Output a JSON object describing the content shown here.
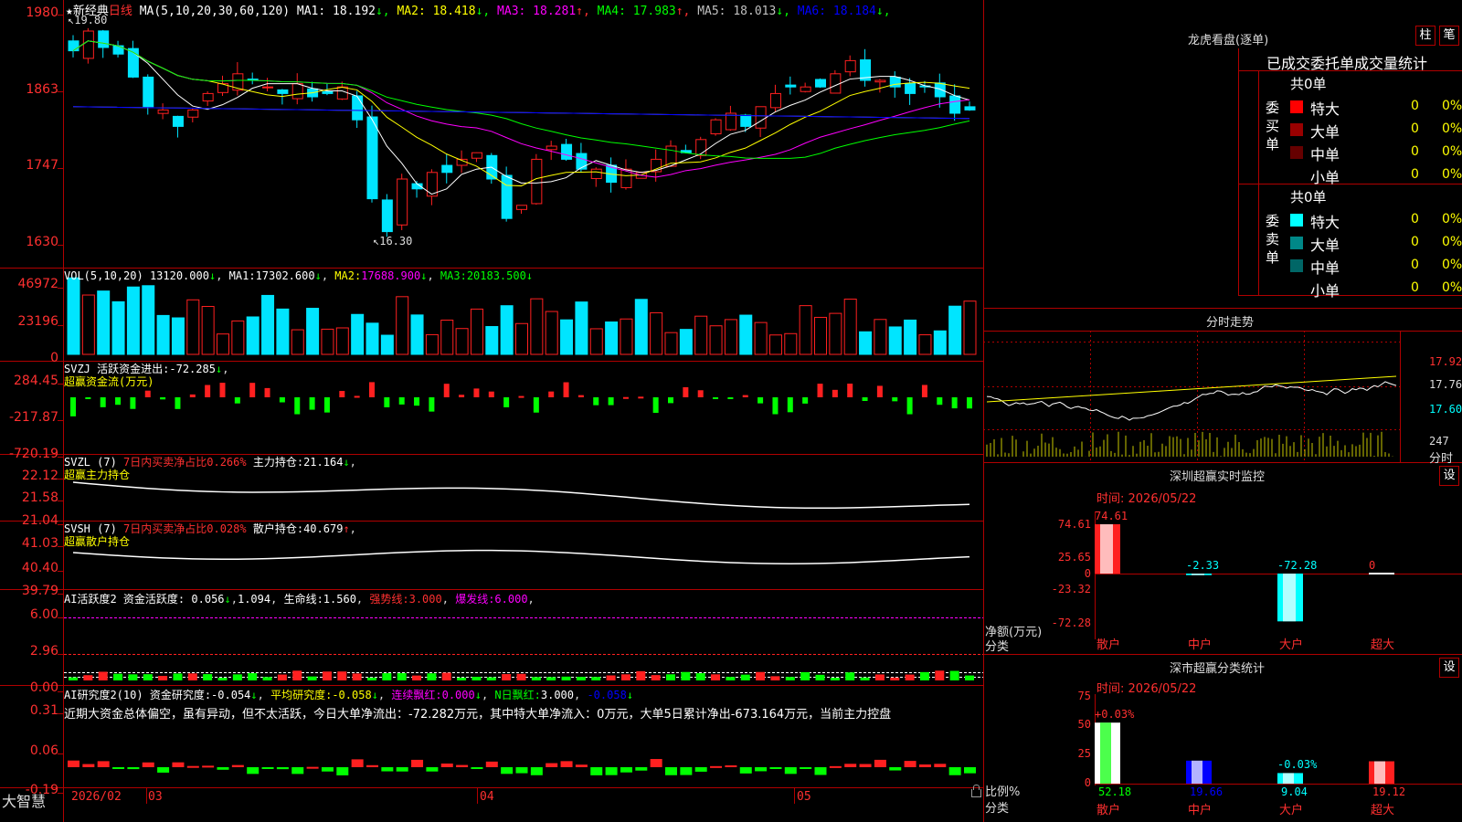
{
  "app": {
    "brand": "大智慧",
    "lock_icon": "lock-icon"
  },
  "kline": {
    "header": {
      "star": "★",
      "name": "新经典",
      "period": "日线",
      "ma_params": "MA(5,10,20,30,60,120)",
      "items": [
        {
          "label": "MA1:",
          "value": "18.192",
          "arrow": "↓",
          "color": "#ffffff"
        },
        {
          "label": "MA2:",
          "value": "18.418",
          "arrow": "↓",
          "color": "#ffff00"
        },
        {
          "label": "MA3:",
          "value": "18.281",
          "arrow": "↑",
          "color": "#ff00ff"
        },
        {
          "label": "MA4:",
          "value": "17.983",
          "arrow": "↑",
          "color": "#00ff00"
        },
        {
          "label": "MA5:",
          "value": "18.013",
          "arrow": "↓",
          "color": "#c0c0c0"
        },
        {
          "label": "MA6:",
          "value": "18.184",
          "arrow": "↓",
          "color": "#0000ff"
        }
      ]
    },
    "y_ticks": [
      "1980",
      "1863",
      "1747",
      "1630"
    ],
    "high_label": "19.80",
    "low_label": "16.30"
  },
  "volume": {
    "header": {
      "name": "VOL(5,10,20)",
      "value": "13120.000",
      "arrow": "↓",
      "ma1": "17302.600",
      "ma2": "17688.900",
      "ma3": "20183.500"
    },
    "ma_labels": [
      "MA1:",
      "MA2:",
      "MA3:"
    ],
    "y_ticks": [
      "46972",
      "23196",
      "0"
    ]
  },
  "svzj": {
    "header": {
      "name": "SVZJ",
      "label": "活跃资金进出:",
      "value": "-72.285",
      "arrow": "↓",
      "sub": "超赢资金流(万元)"
    },
    "y_ticks": [
      "284.45",
      "-217.87",
      "-720.19"
    ]
  },
  "svzl": {
    "header": {
      "name": "SVZL (7)",
      "label1": "7日内买卖净占比0.266%",
      "label2": "主力持仓:",
      "value": "21.164",
      "arrow": "↓",
      "sub": "超赢主力持仓"
    },
    "y_ticks": [
      "22.12",
      "21.58",
      "21.04"
    ]
  },
  "svsh": {
    "header": {
      "name": "SVSH (7)",
      "label1": "7日内买卖净占比0.028%",
      "label2": "散户持仓:",
      "value": "40.679",
      "arrow": "↑",
      "sub": "超赢散户持仓"
    },
    "y_ticks": [
      "41.03",
      "40.40",
      "39.79"
    ]
  },
  "ai_active": {
    "header": {
      "name": "AI活跃度2",
      "label": "资金活跃度:",
      "v1": "0.056",
      "a1": "↓",
      "v2": "1.094",
      "life": "生命线:",
      "v3": "1.560",
      "strong": "强势线:",
      "v4": "3.000",
      "burst": "爆发线:",
      "v5": "6.000"
    },
    "y_ticks": [
      "6.00",
      "2.96",
      "0.00"
    ]
  },
  "ai_research": {
    "header": {
      "name": "AI研究度2(10)",
      "label": "资金研究度:",
      "v1": "-0.054",
      "a1": "↓",
      "avg": "平均研究度:",
      "v2": "-0.058",
      "a2": "↓",
      "lx": "连续飘红:",
      "v3": "0.000",
      "a3": "↓",
      "nr": "N日飘红:",
      "v4": "3.000",
      "v5": "-0.058",
      "a5": "↓"
    },
    "comment": "近期大资金总体偏空，虽有异动，但不太活跃，今日大单净流出：-72.282万元，其中特大单净流入：0万元，大单5日累计净出-673.164万元，当前主力控盘",
    "y_ticks": [
      "0.31",
      "0.06",
      "-0.19"
    ]
  },
  "timeline": {
    "date1": "2026/02",
    "m3": "03",
    "m4": "04",
    "m5": "05"
  },
  "right": {
    "dragon_title": "龙虎看盘(逐单)",
    "tab_bar": "柱",
    "tab_pen": "笔",
    "stats_title": "已成交委托单成交量统计",
    "buy_side": {
      "label": "委买单",
      "total": "共0单",
      "rows": [
        {
          "name": "特大",
          "count": "0",
          "pct": "0%",
          "color": "#ff0000"
        },
        {
          "name": "大单",
          "count": "0",
          "pct": "0%",
          "color": "#990000"
        },
        {
          "name": "中单",
          "count": "0",
          "pct": "0%",
          "color": "#660000"
        },
        {
          "name": "小单",
          "count": "0",
          "pct": "0%",
          "color": "#000000"
        }
      ]
    },
    "sell_side": {
      "label": "委卖单",
      "total": "共0单",
      "rows": [
        {
          "name": "特大",
          "count": "0",
          "pct": "0%",
          "color": "#00ffff"
        },
        {
          "name": "大单",
          "count": "0",
          "pct": "0%",
          "color": "#008888"
        },
        {
          "name": "中单",
          "count": "0",
          "pct": "0%",
          "color": "#006666"
        },
        {
          "name": "小单",
          "count": "0",
          "pct": "0%",
          "color": "#000000"
        }
      ]
    },
    "intraday": {
      "title": "分时走势",
      "prices": [
        "17.92",
        "17.76",
        "17.60"
      ],
      "vol": "247",
      "vol_label": "分时"
    },
    "monitor": {
      "title": "深圳超赢实时监控",
      "set": "设",
      "time": "时间: 2026/05/22",
      "y_ticks": [
        "74.61",
        "25.65",
        "0",
        "-23.32",
        "-72.28"
      ],
      "bars": [
        {
          "cat": "散户",
          "value": 74.61,
          "label": "74.61"
        },
        {
          "cat": "中户",
          "value": -2.33,
          "label": "-2.33"
        },
        {
          "cat": "大户",
          "value": -72.28,
          "label": "-72.28"
        },
        {
          "cat": "超大",
          "value": 0,
          "label": "0"
        }
      ],
      "legend1": "净额(万元)",
      "legend2": "分类"
    },
    "classify": {
      "title": "深市超赢分类统计",
      "set": "设",
      "time": "时间: 2026/05/22",
      "y_ticks": [
        "75",
        "50",
        "25",
        "0"
      ],
      "bars": [
        {
          "cat": "散户",
          "value": 52.18,
          "label": "52.18",
          "delta": "+0.03%"
        },
        {
          "cat": "中户",
          "value": 19.66,
          "label": "19.66",
          "delta": ""
        },
        {
          "cat": "大户",
          "value": 9.04,
          "label": "9.04",
          "delta": "-0.03%"
        },
        {
          "cat": "超大",
          "value": 19.12,
          "label": "19.12",
          "delta": ""
        }
      ],
      "legend1": "比例%",
      "legend2": "分类"
    }
  },
  "colors": {
    "up": "#ff2020",
    "down": "#00e5ff",
    "grid": "#b00000",
    "green": "#00ff00"
  }
}
